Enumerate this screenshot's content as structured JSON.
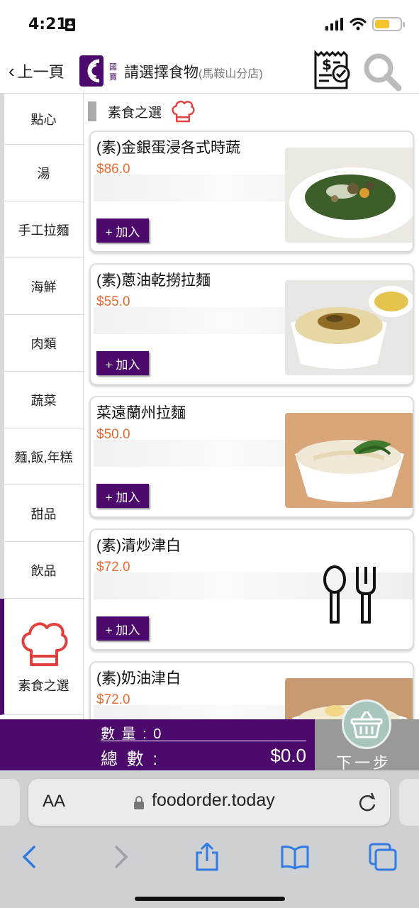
{
  "status": {
    "time": "4:21"
  },
  "header": {
    "back_label": "上一頁",
    "logo_text": "國寶",
    "title": "請選擇食物",
    "branch": "(馬鞍山分店)"
  },
  "sidebar": {
    "items": [
      {
        "label": "點心"
      },
      {
        "label": "湯"
      },
      {
        "label": "手工拉麵"
      },
      {
        "label": "海鮮"
      },
      {
        "label": "肉類"
      },
      {
        "label": "蔬菜"
      },
      {
        "label": "麵,飯,年糕"
      },
      {
        "label": "甜品"
      },
      {
        "label": "飲品"
      },
      {
        "label": "素食之選",
        "active": true
      }
    ]
  },
  "section": {
    "title": "素食之選"
  },
  "menu_items": [
    {
      "name": "(素)金銀蛋浸各式時蔬",
      "price": "$86.0",
      "add_label": "+ 加入",
      "image": "greens-with-eggs"
    },
    {
      "name": "(素)蔥油乾撈拉麵",
      "price": "$55.0",
      "add_label": "+ 加入",
      "image": "scallion-oil-noodles"
    },
    {
      "name": "菜遠蘭州拉麵",
      "price": "$50.0",
      "add_label": "+ 加入",
      "image": "lanzhou-noodle-soup"
    },
    {
      "name": "(素)清炒津白",
      "price": "$72.0",
      "add_label": "+ 加入",
      "image": "cutlery-placeholder-icon"
    },
    {
      "name": "(素)奶油津白",
      "price": "$72.0",
      "add_label": "+ 加入",
      "image": "cream-cabbage"
    }
  ],
  "summary": {
    "qty_label": "數 量 :",
    "qty_value": "0",
    "total_label": "總 數 :",
    "total_value": "$0.0",
    "next_label": "下一步"
  },
  "browser": {
    "aa_label": "AA",
    "url": "foodorder.today"
  },
  "colors": {
    "brand_purple": "#4b0a6c",
    "price_orange": "#e46a34",
    "chef_red": "#e0413d"
  }
}
